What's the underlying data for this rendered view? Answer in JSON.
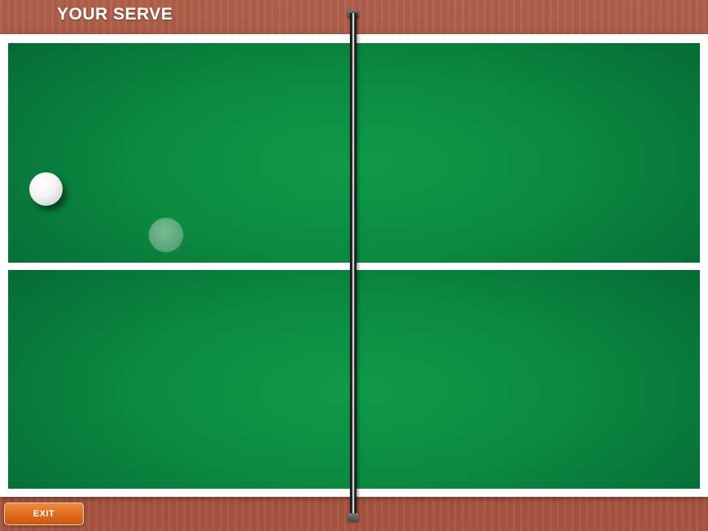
{
  "header": {
    "status_text": "YOUR SERVE"
  },
  "controls": {
    "exit_label": "EXIT"
  },
  "colors": {
    "table_green": "#0b8a40",
    "table_line": "#ffffff",
    "wood_background": "#a0503b",
    "exit_button": "#e06c22"
  },
  "icons": {
    "ball": "ping-pong-ball",
    "ball_shadow": "ball-target-shadow",
    "net": "table-net"
  }
}
